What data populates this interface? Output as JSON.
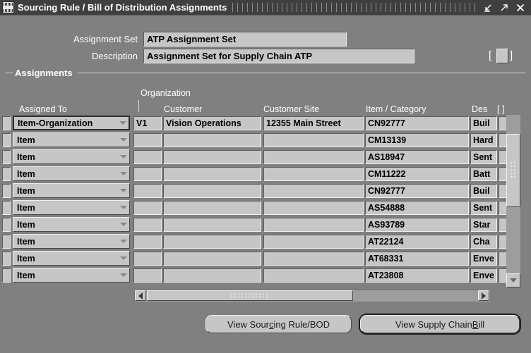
{
  "window": {
    "title": "Sourcing Rule / Bill of Distribution Assignments",
    "icon": "oracle-forms-icon",
    "buttons": [
      {
        "name": "restore-button",
        "glyph": "restore-arrow"
      },
      {
        "name": "maximize-button",
        "glyph": "maximize-arrow"
      },
      {
        "name": "close-button",
        "glyph": "close-x"
      }
    ]
  },
  "header": {
    "assignment_set_label": "Assignment Set",
    "assignment_set_value": "ATP Assignment Set",
    "description_label": "Description",
    "description_value": "Assignment Set for Supply Chain ATP",
    "flexfield_open_bracket": "[",
    "flexfield_close_bracket": "]"
  },
  "group": {
    "title": "Assignments"
  },
  "table": {
    "group_header": "Organization",
    "columns": [
      {
        "name": "assigned-to",
        "label": "Assigned To"
      },
      {
        "name": "organization-code",
        "label": ""
      },
      {
        "name": "customer",
        "label": "Customer"
      },
      {
        "name": "customer-site",
        "label": "Customer Site"
      },
      {
        "name": "item-category",
        "label": "Item / Category"
      },
      {
        "name": "description",
        "label": "Des"
      },
      {
        "name": "flexfield",
        "label": "[  ]"
      }
    ],
    "rows": [
      {
        "assigned_to": "Item-Organization",
        "org": "V1",
        "customer": "Vision Operations",
        "customer_site": "12355 Main Street",
        "item_category": "CN92777",
        "description": "Buil",
        "current": true
      },
      {
        "assigned_to": "Item",
        "org": "",
        "customer": "",
        "customer_site": "",
        "item_category": "CM13139",
        "description": "Hard",
        "current": false
      },
      {
        "assigned_to": "Item",
        "org": "",
        "customer": "",
        "customer_site": "",
        "item_category": "AS18947",
        "description": "Sent",
        "current": false
      },
      {
        "assigned_to": "Item",
        "org": "",
        "customer": "",
        "customer_site": "",
        "item_category": "CM11222",
        "description": "Batt",
        "current": false
      },
      {
        "assigned_to": "Item",
        "org": "",
        "customer": "",
        "customer_site": "",
        "item_category": "CN92777",
        "description": "Buil",
        "current": false
      },
      {
        "assigned_to": "Item",
        "org": "",
        "customer": "",
        "customer_site": "",
        "item_category": "AS54888",
        "description": "Sent",
        "current": false
      },
      {
        "assigned_to": "Item",
        "org": "",
        "customer": "",
        "customer_site": "",
        "item_category": "AS93789",
        "description": "Star",
        "current": false
      },
      {
        "assigned_to": "Item",
        "org": "",
        "customer": "",
        "customer_site": "",
        "item_category": "AT22124",
        "description": "Cha",
        "current": false
      },
      {
        "assigned_to": "Item",
        "org": "",
        "customer": "",
        "customer_site": "",
        "item_category": "AT68331",
        "description": "Enve",
        "current": false
      },
      {
        "assigned_to": "Item",
        "org": "",
        "customer": "",
        "customer_site": "",
        "item_category": "AT23808",
        "description": "Enve",
        "current": false
      }
    ]
  },
  "footer": {
    "view_sourcing_rule_pre": "View Sour",
    "view_sourcing_rule_mn": "c",
    "view_sourcing_rule_post": "ing Rule/BOD",
    "view_supply_chain_pre": "View Supply Chain ",
    "view_supply_chain_mn": "B",
    "view_supply_chain_post": "ill"
  },
  "colors": {
    "desktop": "#808080",
    "titlebar": "#3f3f3f",
    "widget_face": "#c6c6c6",
    "scroll_track": "#9d9d9d",
    "label_text": "#ffffff",
    "value_text": "#000000"
  }
}
